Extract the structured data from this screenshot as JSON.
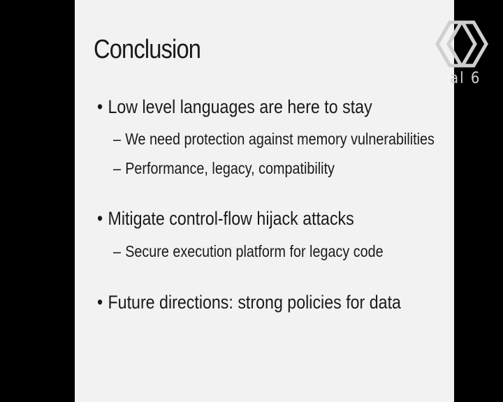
{
  "slide": {
    "title": "Conclusion",
    "bullets": [
      {
        "text": "Low level languages are here to stay",
        "subs": [
          "We need protection against memory vulnerabilities",
          "Performance, legacy, compatibility"
        ]
      },
      {
        "text": "Mitigate control-flow hijack attacks",
        "subs": [
          "Secure execution platform for legacy code"
        ]
      },
      {
        "text": "Future directions: strong policies for data",
        "subs": []
      }
    ],
    "bullet_glyph": "•",
    "sub_glyph": "–"
  },
  "overlay": {
    "logo_icon": "double-chevron-logo-icon",
    "logo_text": "al 6"
  },
  "colors": {
    "background": "#000000",
    "slide": "#f2f2f2",
    "text": "#1a1a1a",
    "logo": "#cfcfcf"
  }
}
